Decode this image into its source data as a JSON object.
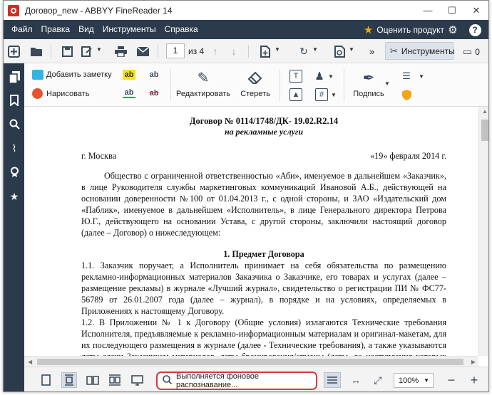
{
  "window": {
    "title": "Договор_new - ABBYY FineReader 14",
    "minimize": "—",
    "maximize": "☐",
    "close": "✕"
  },
  "menu": {
    "items": [
      "Файл",
      "Правка",
      "Вид",
      "Инструменты",
      "Справка"
    ],
    "rate_label": "Оценить продукт"
  },
  "toolbar": {
    "page_current": "1",
    "page_of": "из 4",
    "more": "»",
    "tools_label": "Инструменты",
    "comments_count": "0"
  },
  "ribbon": {
    "add_note": "Добавить заметку",
    "draw": "Нарисовать",
    "highlight_glyph": "ab",
    "edit_label": "Редактировать",
    "erase_label": "Стереть",
    "sign_label": "Подпись",
    "hash_glyph": "#"
  },
  "document": {
    "title": "Договор № 0114/1748/ДК- 19.02.R2.14",
    "subtitle": "на рекламные услуги",
    "city": "г. Москва",
    "date": "«19» февраля 2014 г.",
    "intro": "Общество с ограниченной ответственностью «Аби», именуемое в дальнейшем «Заказчик», в лице Руководителя службы маркетинговых коммуникаций Ивановой А.Б., действующей на основании доверенности №100 от 01.04.2013 г., с одной стороны, и ЗАО «Издательский дом «Паблик», именуемое в дальнейшем «Исполнитель», в лице Генерального директора Петрова Ю.Г., действующего на основании Устава, с другой стороны, заключили настоящий договор (далее – Договор) о нижеследующем:",
    "section1": "1.    Предмет Договора",
    "p1_1": "1.1. Заказчик поручает, а Исполнитель принимает на себя обязательства по размещению рекламно-информационных материалов Заказчика о Заказчике, его товарах и услугах (далее – размещение рекламы) в журнале «Лучший журнал», свидетельство о регистрации ПИ № ФС77-56789 от 26.01.2007 года (далее – журнал), в порядке и на условиях, определяемых в Приложениях к настоящему Договору.",
    "p1_2": "1.2. В Приложении № 1 к Договору (Общие условия)  излагаются Технические требования Исполнителя, предъявляемые к рекламно-информационным материалам и оригинал-макетам, для их последующего размещения в журнале (далее - Технические требования), а также указываются даты сдачи Заказчиком материалов, даты бронирования/отмены (даты, до наступления которых Заказчик обязан внести возможные изменения в"
  },
  "status": {
    "recognition_text": "Выполняется фоновое распознавание...",
    "zoom": "100%"
  },
  "colors": {
    "chrome_dark": "#2b3b4b",
    "accent_red": "#d33a3a",
    "star": "#f2a51a",
    "highlight_yellow": "#f7e11a"
  }
}
